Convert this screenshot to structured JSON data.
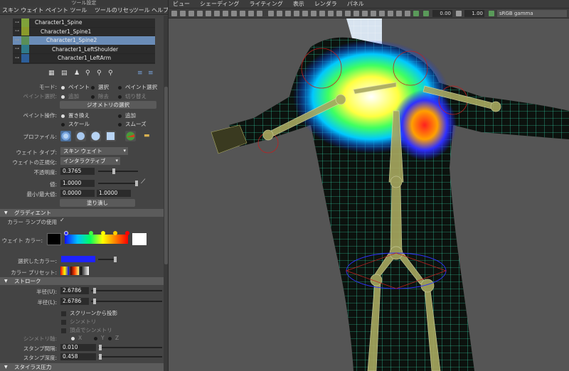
{
  "window_title": "ツール設定",
  "left_menu": {
    "title": "スキン ウェイト ペイント ツール",
    "reset": "ツールのリセット",
    "help": "ツール ヘルプ"
  },
  "outliner": [
    {
      "name": "Character1_Spine",
      "color": "#7fa23a",
      "selected": false
    },
    {
      "name": "Character1_Spine1",
      "color": "#8a9a2a",
      "selected": false
    },
    {
      "name": "Character1_Spine2",
      "color": "#5a8f58",
      "selected": true
    },
    {
      "name": "Character1_LeftShoulder",
      "color": "#2f7a8a",
      "selected": false
    },
    {
      "name": "Character1_LeftArm",
      "color": "#2d5f9a",
      "selected": false
    }
  ],
  "mode": {
    "label": "モード:",
    "opt1": "ペイント",
    "opt2": "選択",
    "opt3": "ペイント選択"
  },
  "paint_select": {
    "label": "ペイント選択:",
    "opt1": "追加",
    "opt2": "除去",
    "opt3": "切り替え"
  },
  "select_geometry": "ジオメトリの選択",
  "paint_op": {
    "label": "ペイント操作:",
    "replace": "置き換え",
    "add": "追加",
    "scale": "スケール",
    "smooth": "スムーズ"
  },
  "profile_label": "プロファイル:",
  "weight_type": {
    "label": "ウェイト タイプ:",
    "value": "スキン ウェイト"
  },
  "normalize": {
    "label": "ウェイトの正規化:",
    "value": "インタラクティブ"
  },
  "opacity": {
    "label": "不透明度:",
    "value": "0.3765",
    "level": 0.3765
  },
  "value": {
    "label": "値:",
    "value": "1.0000",
    "level": 1.0
  },
  "minmax": {
    "label": "最小/最大値:",
    "min": "0.0000",
    "max": "1.0000"
  },
  "flood": "塗り潰し",
  "gradient": {
    "title": "グラディエント",
    "use_ramp": "カラー ランプの使用",
    "weight_color": "ウェイト カラー:",
    "selected_color": "選択したカラー:",
    "presets": "カラー プリセット:"
  },
  "stroke": {
    "title": "ストローク",
    "radius_u": {
      "label": "半径(U):",
      "value": "2.6786"
    },
    "radius_l": {
      "label": "半径(L):",
      "value": "2.6786"
    },
    "screen_proj": "スクリーンから投影",
    "mirror": "シンメトリ",
    "mirror_pt": "頂点でシンメトリ",
    "mirror_axis": "シンメトリ軸:",
    "x": "X",
    "y": "Y",
    "z": "Z",
    "stamp_spacing": {
      "label": "スタンプ間隔:",
      "value": "0.010"
    },
    "stamp_depth": {
      "label": "スタンプ深度:",
      "value": "0.458"
    }
  },
  "stylus": {
    "title": "スタイラス圧力"
  },
  "viewport_menu": [
    "ビュー",
    "シェーディング",
    "ライティング",
    "表示",
    "レンダラ",
    "パネル"
  ],
  "viewport_toolbar": {
    "val1": "0.00",
    "val2": "1.00",
    "colorspace": "sRGB gamma"
  },
  "colors": {
    "accent": "#6a8cb7",
    "selected_color_swatch": "#1e22ff",
    "mesh": "#3cf0c0"
  }
}
